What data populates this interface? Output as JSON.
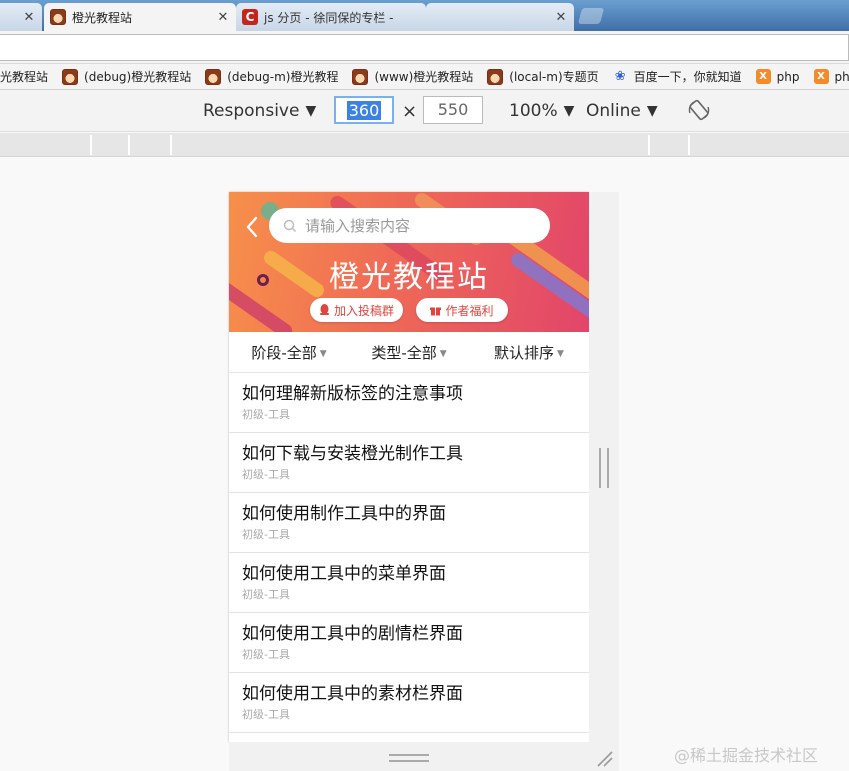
{
  "tabs": [
    {
      "title": "",
      "state": "inactive"
    },
    {
      "title": "橙光教程站",
      "state": "active"
    },
    {
      "title": "js 分页 - 徐同保的专栏 -",
      "state": "inactive"
    },
    {
      "title": "",
      "state": "inactive"
    }
  ],
  "bookmarks": [
    {
      "label": "光教程站"
    },
    {
      "label": "(debug)橙光教程站"
    },
    {
      "label": "(debug-m)橙光教程"
    },
    {
      "label": "(www)橙光教程站"
    },
    {
      "label": "(local-m)专题页"
    },
    {
      "label": "百度一下，你就知道"
    },
    {
      "label": "php"
    },
    {
      "label": "ph"
    }
  ],
  "device_toolbar": {
    "mode": "Responsive",
    "width": "360",
    "times": "×",
    "height": "550",
    "zoom": "100%",
    "network": "Online"
  },
  "page": {
    "search_placeholder": "请输入搜索内容",
    "site_title": "橙光教程站",
    "btn_join": "加入投稿群",
    "btn_welfare": "作者福利",
    "filters": [
      "阶段-全部",
      "类型-全部",
      "默认排序"
    ],
    "items": [
      {
        "title": "如何理解新版标签的注意事项",
        "meta": "初级-工具"
      },
      {
        "title": "如何下载与安装橙光制作工具",
        "meta": "初级-工具"
      },
      {
        "title": "如何使用制作工具中的界面",
        "meta": "初级-工具"
      },
      {
        "title": "如何使用工具中的菜单界面",
        "meta": "初级-工具"
      },
      {
        "title": "如何使用工具中的剧情栏界面",
        "meta": "初级-工具"
      },
      {
        "title": "如何使用工具中的素材栏界面",
        "meta": "初级-工具"
      }
    ]
  },
  "watermark": "@稀土掘金技术社区",
  "colors": {
    "accent": "#3a82e4",
    "banner_start": "#f7904a",
    "banner_end": "#e2456a",
    "pill_text": "#e0443e"
  }
}
